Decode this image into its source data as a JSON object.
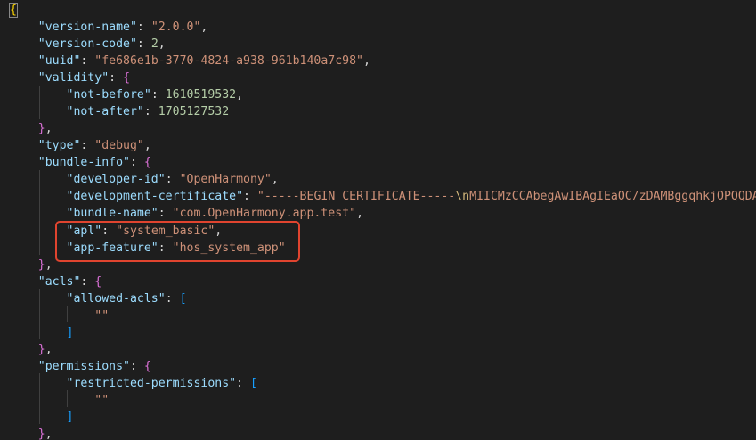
{
  "lines": [
    {
      "key": "",
      "open": "{"
    },
    {
      "key": "\"version-name\"",
      "value": "\"2.0.0\"",
      "vtype": "s",
      "comma": ","
    },
    {
      "key": "\"version-code\"",
      "value": "2",
      "vtype": "n",
      "comma": ","
    },
    {
      "key": "\"uuid\"",
      "value": "\"fe686e1b-3770-4824-a938-961b140a7c98\"",
      "vtype": "s",
      "comma": ","
    },
    {
      "key": "\"validity\"",
      "open": "{"
    },
    {
      "key": "\"not-before\"",
      "value": "1610519532",
      "vtype": "n",
      "comma": ","
    },
    {
      "key": "\"not-after\"",
      "value": "1705127532",
      "vtype": "n",
      "comma": ""
    },
    {
      "close": "}",
      "comma": ","
    },
    {
      "key": "\"type\"",
      "value": "\"debug\"",
      "vtype": "s",
      "comma": ","
    },
    {
      "key": "\"bundle-info\"",
      "open": "{"
    },
    {
      "key": "\"developer-id\"",
      "value": "\"OpenHarmony\"",
      "vtype": "s",
      "comma": ","
    },
    {
      "key": "\"development-certificate\"",
      "value_pre": "\"-----BEGIN CERTIFICATE-----",
      "value_esc": "\\n",
      "value_post": "MIICMzCCAbegAwIBAgIEaOC/zDAMBggqhkjOPQQDAwUA"
    },
    {
      "key": "\"bundle-name\"",
      "value": "\"com.OpenHarmony.app.test\"",
      "vtype": "s",
      "comma": ","
    },
    {
      "key": "\"apl\"",
      "value": "\"system_basic\"",
      "vtype": "s",
      "comma": ","
    },
    {
      "key": "\"app-feature\"",
      "value": "\"hos_system_app\"",
      "vtype": "s",
      "comma": ""
    },
    {
      "close": "}",
      "comma": ","
    },
    {
      "key": "\"acls\"",
      "open": "{"
    },
    {
      "key": "\"allowed-acls\"",
      "open": "["
    },
    {
      "value": "\"\"",
      "vtype": "s"
    },
    {
      "close": "]"
    },
    {
      "close": "}",
      "comma": ","
    },
    {
      "key": "\"permissions\"",
      "open": "{"
    },
    {
      "key": "\"restricted-permissions\"",
      "open": "["
    },
    {
      "value": "\"\"",
      "vtype": "s"
    },
    {
      "close": "]"
    },
    {
      "close": "}",
      "comma": ","
    }
  ],
  "punct": {
    "colon": ": ",
    "comma": ","
  },
  "colors": {
    "background": "#1e1e1e",
    "key": "#9cdcfe",
    "string": "#ce9178",
    "number": "#b5cea8",
    "bracket_level1": "#ffd700",
    "bracket_level2": "#da70d6",
    "bracket_level3": "#179fff",
    "highlight_box": "#e0442f"
  }
}
